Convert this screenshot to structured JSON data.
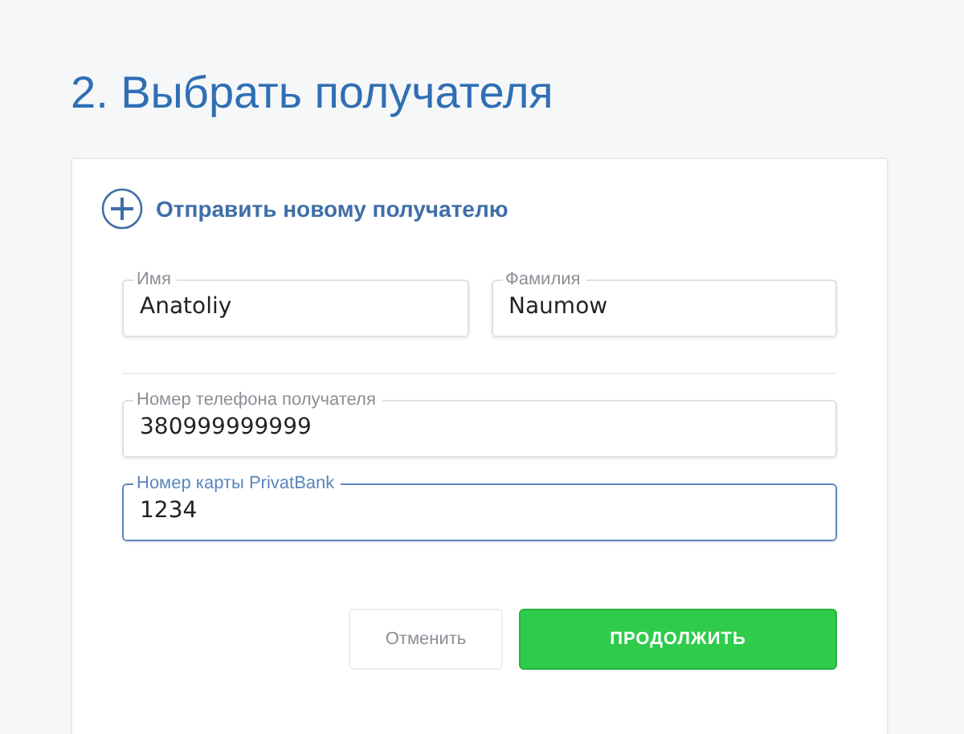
{
  "title": "2. Выбрать получателя",
  "new_recipient": {
    "label": "Отправить новому получателю"
  },
  "name_fields": [
    {
      "label": "Имя",
      "value": "Anatoliy",
      "focused": false
    },
    {
      "label": "Фамилия",
      "value": "Naumow",
      "focused": false
    }
  ],
  "contact_fields": [
    {
      "label": "Номер телефона получателя",
      "value": "380999999999",
      "focused": false
    },
    {
      "label": "Номер карты PrivatBank",
      "value": "1234",
      "focused": true
    }
  ],
  "buttons": [
    {
      "label": "Отменить",
      "kind": "secondary"
    },
    {
      "label": "ПРОДОЛЖИТЬ",
      "kind": "primary"
    }
  ]
}
